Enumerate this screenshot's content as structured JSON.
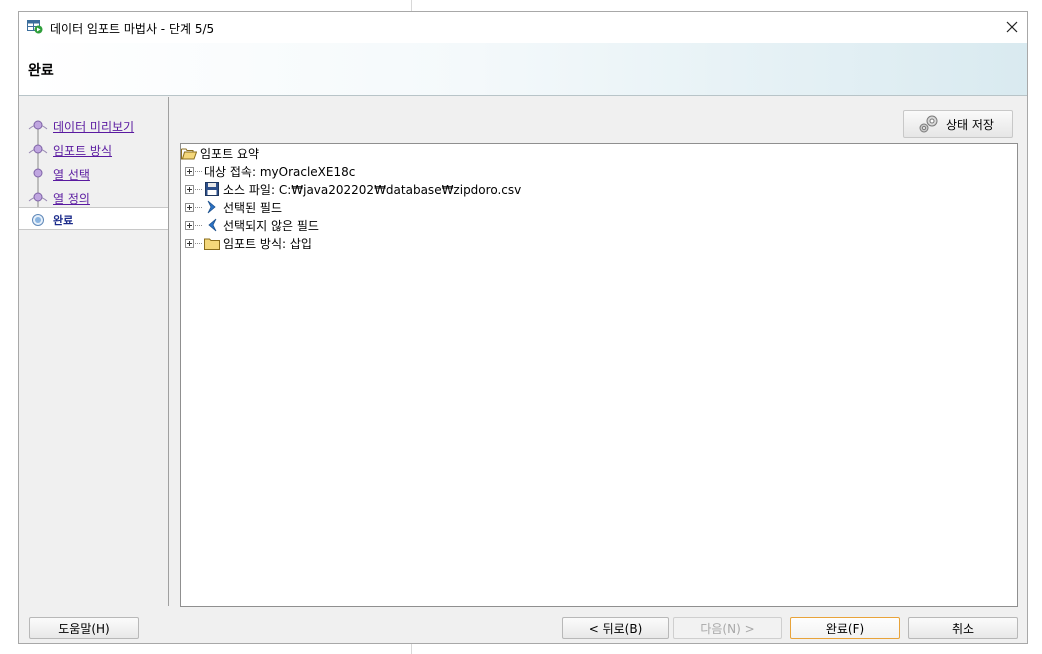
{
  "window": {
    "title": "데이터 임포트 마법사 - 단계 5/5",
    "close_glyph": "✕"
  },
  "header": {
    "title": "완료"
  },
  "steps": [
    {
      "label": "데이터 미리보기",
      "state": "visited"
    },
    {
      "label": "임포트 방식",
      "state": "visited"
    },
    {
      "label": "열 선택",
      "state": "visited"
    },
    {
      "label": "열 정의",
      "state": "visited"
    },
    {
      "label": "완료",
      "state": "current"
    }
  ],
  "toolbar": {
    "save_state_label": "상태 저장",
    "save_state_icon": "gears-icon"
  },
  "tree": {
    "root": {
      "label": "임포트 요약",
      "icon": "folder-open-icon"
    },
    "items": [
      {
        "label": "대상 접속: myOracleXE18c",
        "icon": "none"
      },
      {
        "label": "소스 파일: C:₩java202202₩database₩zipdoro.csv",
        "icon": "floppy-disk-icon"
      },
      {
        "label": "선택된 필드",
        "icon": "chevron-right-icon"
      },
      {
        "label": "선택되지 않은 필드",
        "icon": "chevron-left-icon"
      },
      {
        "label": "임포트 방식: 삽입",
        "icon": "folder-icon"
      }
    ]
  },
  "footer": {
    "help_label": "도움말(H)",
    "back_label": "< 뒤로(B)",
    "next_label": "다음(N) >",
    "finish_label": "완료(F)",
    "cancel_label": "취소"
  },
  "colors": {
    "visited_link": "#5a1aa0",
    "current_step": "#1b2b8a",
    "default_button_border": "#e8a33a",
    "header_gradient_end": "#d9eaf0"
  }
}
